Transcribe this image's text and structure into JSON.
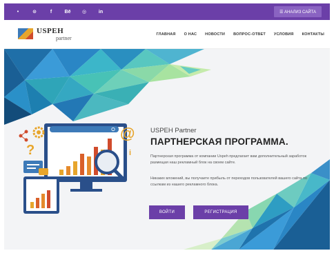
{
  "topbar": {
    "social": [
      {
        "icon": "twitter-icon",
        "glyph": "•"
      },
      {
        "icon": "pinterest-icon",
        "glyph": "⊙"
      },
      {
        "icon": "facebook-icon",
        "glyph": "f"
      },
      {
        "icon": "behance-icon",
        "glyph": "Bē"
      },
      {
        "icon": "instagram-icon",
        "glyph": "◎"
      },
      {
        "icon": "linkedin-icon",
        "glyph": "in"
      }
    ],
    "analyze_label": "☰ АНАЛИЗ САЙТА"
  },
  "logo": {
    "name": "USPEH",
    "sub": "partner"
  },
  "menu": [
    "ГЛАВНАЯ",
    "О НАС",
    "НОВОСТИ",
    "ВОПРОС-ОТВЕТ",
    "УСЛОВИЯ",
    "КОНТАКТЫ"
  ],
  "hero": {
    "subtitle": "USPEH Partner",
    "title": "ПАРТНЕРСКАЯ ПРОГРАММА.",
    "paragraph1": "Партнерская программа от компании Uspeh предлагает вам дополнительный заработок размещая наш рекламный блок на своем сайте.",
    "paragraph2": "Никаких вложений, вы получаете прибыль от переходов пользователей вашего сайта по ссылкам из нашего рекламного блока.",
    "login_label": "ВОЙТИ",
    "register_label": "РЕГИСТРАЦИЯ"
  },
  "colors": {
    "brand": "#6b3fa8",
    "accent": "#e7a52c",
    "blue": "#3d7ab8"
  }
}
